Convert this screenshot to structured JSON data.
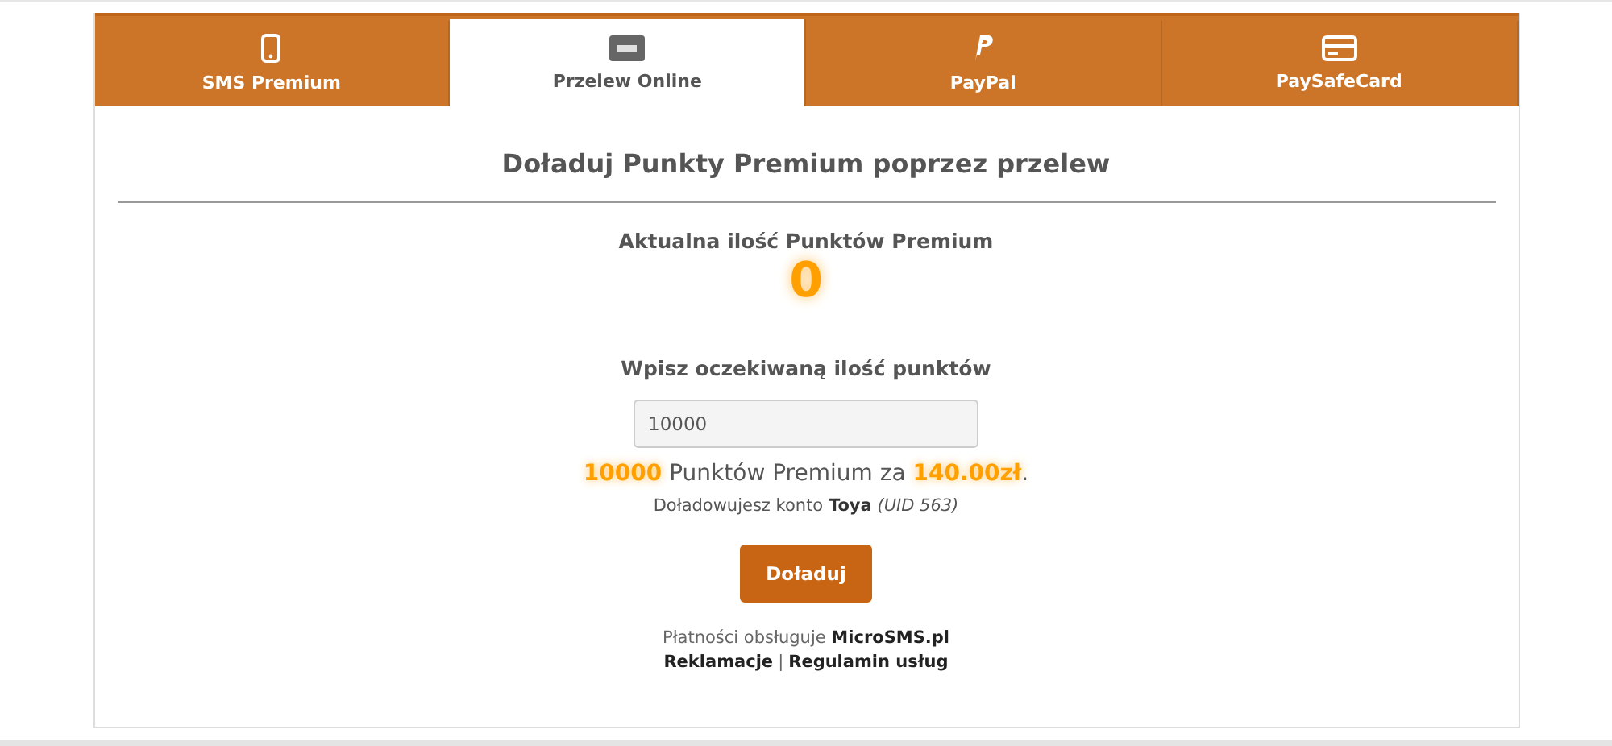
{
  "tabs": [
    {
      "label": "SMS Premium",
      "kind": "phone",
      "selected": false
    },
    {
      "label": "Przelew Online",
      "kind": "visa",
      "selected": true
    },
    {
      "label": "PayPal",
      "kind": "paypal",
      "selected": false
    },
    {
      "label": "PaySafeCard",
      "kind": "card",
      "selected": false
    }
  ],
  "heading": "Doładuj Punkty Premium poprzez przelew",
  "balance": {
    "label": "Aktualna ilość Punktów Premium",
    "value": "0"
  },
  "amount": {
    "label": "Wpisz oczekiwaną ilość punktów",
    "value": "10000"
  },
  "summary": "**10000** Punktów Premium za **140.00zł**.",
  "account": "Doładowujesz konto **Toya** *(UID 563)*",
  "submit_button": "Doładuj",
  "provider": "Płatności obsługuje **MicroSMS.pl**",
  "footer_links": [
    "Reklamacje",
    "Regulamin usług"
  ],
  "separator": "|"
}
